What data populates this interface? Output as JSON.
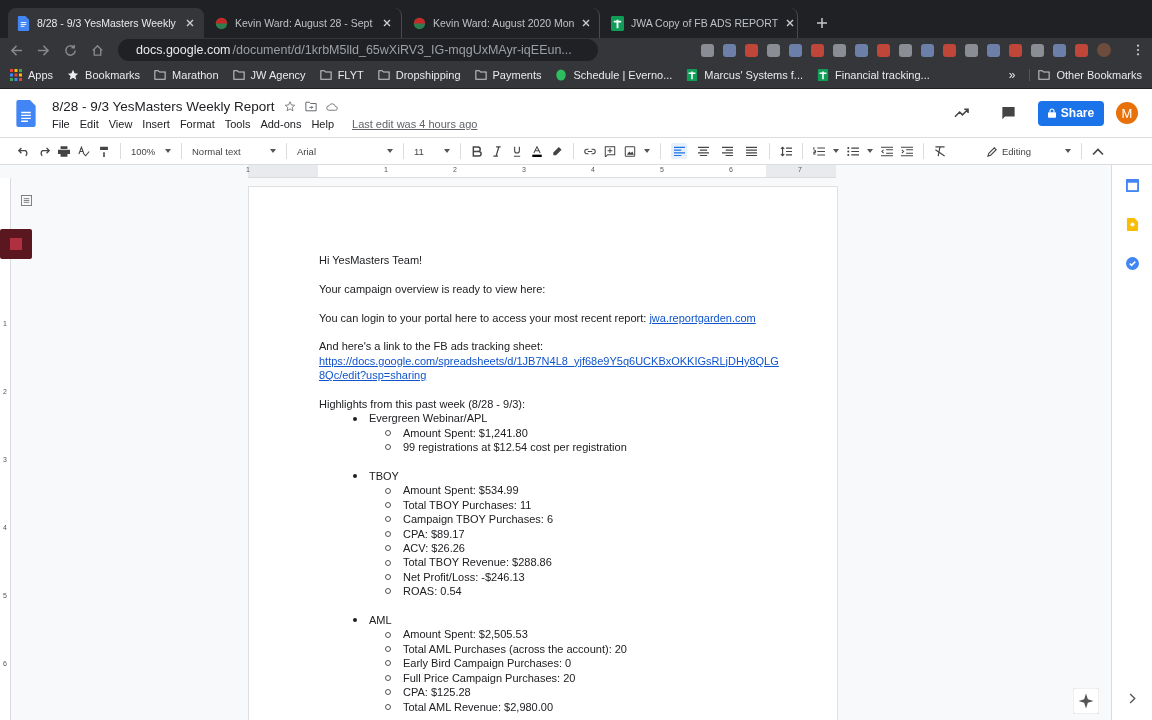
{
  "browser": {
    "tabs": [
      {
        "title": "8/28 - 9/3 YesMasters Weekly",
        "kind": "docs",
        "selected": true
      },
      {
        "title": "Kevin Ward: August 28 - Sept",
        "kind": "web",
        "selected": false
      },
      {
        "title": "Kevin Ward: August 2020 Mon",
        "kind": "web",
        "selected": false
      },
      {
        "title": "JWA Copy of FB ADS REPORT",
        "kind": "sheets",
        "selected": false
      }
    ],
    "url": {
      "domain": "docs.google.com",
      "path": "/document/d/1krbM5lld_65wXiRV3_IG-mqgUxMAyr-iqEEun..."
    },
    "bookmarks": [
      {
        "label": "Apps",
        "kind": "apps"
      },
      {
        "label": "Bookmarks",
        "kind": "star"
      },
      {
        "label": "Marathon",
        "kind": "folder"
      },
      {
        "label": "JW Agency",
        "kind": "folder"
      },
      {
        "label": "FLYT",
        "kind": "folder"
      },
      {
        "label": "Dropshipping",
        "kind": "folder"
      },
      {
        "label": "Payments",
        "kind": "folder"
      },
      {
        "label": "Schedule | Everno...",
        "kind": "evernote"
      },
      {
        "label": "Marcus' Systems f...",
        "kind": "sheets"
      },
      {
        "label": "Financial tracking...",
        "kind": "sheets"
      }
    ],
    "more": "»",
    "other_bookmarks": "Other Bookmarks"
  },
  "docs": {
    "title": "8/28 - 9/3 YesMasters Weekly Report",
    "menu": [
      "File",
      "Edit",
      "View",
      "Insert",
      "Format",
      "Tools",
      "Add-ons",
      "Help"
    ],
    "last_edit": "Last edit was 4 hours ago",
    "share": "Share",
    "avatar": "M",
    "toolbar": {
      "zoom": "100%",
      "style": "Normal text",
      "font": "Arial",
      "size": "11",
      "mode": "Editing",
      "align": [
        {
          "selected": true
        },
        {
          "selected": false
        },
        {
          "selected": false
        },
        {
          "selected": false
        }
      ]
    },
    "ruler": [
      "1",
      "1",
      "2",
      "3",
      "4",
      "5",
      "6",
      "7"
    ],
    "vruler": [
      "1",
      "2",
      "3",
      "4",
      "5",
      "6"
    ]
  },
  "document": {
    "blocks": [
      {
        "kind": "para",
        "text": "Hi YesMasters Team!"
      },
      {
        "kind": "para",
        "text": "Your campaign overview is ready to view here:"
      },
      {
        "kind": "para",
        "text": "You can login to your portal here to access your most recent report: ",
        "link": "jwa.reportgarden.com"
      },
      {
        "kind": "para",
        "text": "And here's a link to the FB ads tracking sheet:",
        "link": "https://docs.google.com/spreadsheets/d/1JB7N4L8_yjf68e9Y5q6UCKBxOKKIGsRLjDHy8QLG8Qc/edit?usp=sharing",
        "link_block": true
      },
      {
        "kind": "list",
        "text": "Highlights from this past week (8/28 - 9/3):",
        "items": [
          {
            "text": "Evergreen Webinar/APL",
            "children": [
              {
                "text": "Amount Spent: $1,241.80"
              },
              {
                "text": "99 registrations at $12.54 cost per registration"
              }
            ]
          },
          {
            "text": "TBOY",
            "children": [
              {
                "text": "Amount Spent: $534.99"
              },
              {
                "text": "Total TBOY Purchases: 11"
              },
              {
                "text": "Campaign TBOY Purchases: 6"
              },
              {
                "text": "CPA: $89.17"
              },
              {
                "text": "ACV: $26.26"
              },
              {
                "text": "Total TBOY Revenue: $288.86"
              },
              {
                "text": "Net Profit/Loss: -$246.13"
              },
              {
                "text": "ROAS: 0.54"
              }
            ]
          },
          {
            "text": "AML",
            "children": [
              {
                "text": "Amount Spent: $2,505.53"
              },
              {
                "text": "Total AML Purchases (across the account): 20"
              },
              {
                "text": "Early Bird Campaign Purchases: 0"
              },
              {
                "text": "Full Price Campaign Purchases: 20"
              },
              {
                "text": "CPA: $125.28"
              },
              {
                "text": "Total AML Revenue: $2,980.00"
              }
            ]
          }
        ]
      }
    ]
  }
}
